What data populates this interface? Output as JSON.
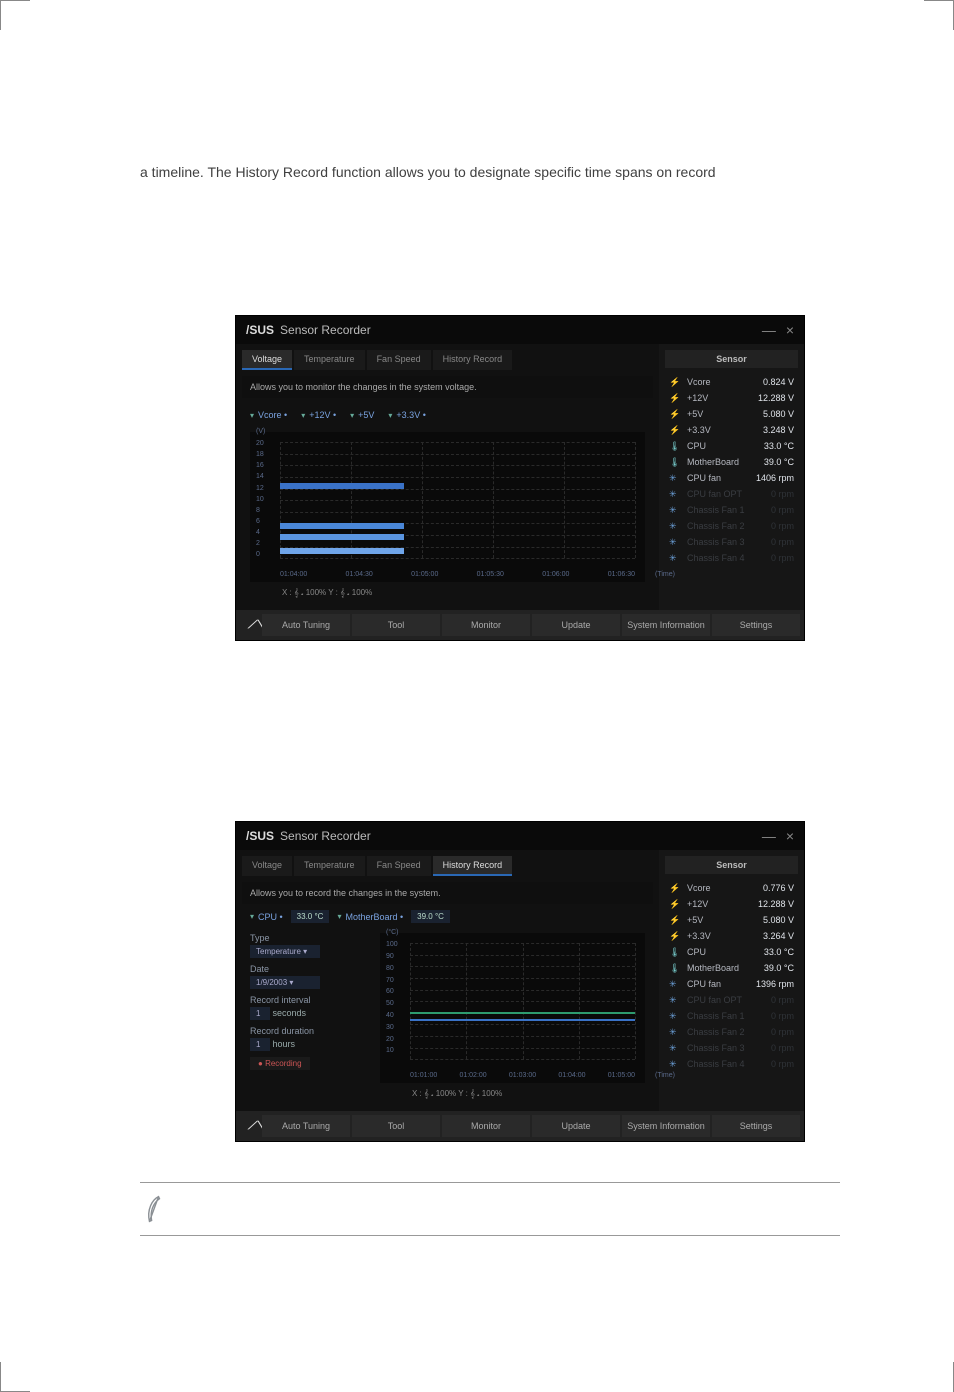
{
  "doc": {
    "paragraph_line": "a timeline. The History Record function allows you to designate specific time spans on record"
  },
  "window": {
    "brand": "/SUS",
    "title": "Sensor Recorder",
    "controls": {
      "min": "—",
      "close": "×"
    }
  },
  "tabs": {
    "voltage": "Voltage",
    "temperature": "Temperature",
    "fan": "Fan Speed",
    "history": "History Record"
  },
  "voltage_view": {
    "desc": "Allows you to monitor the changes in the system voltage.",
    "toggles": [
      "Vcore •",
      "+12V •",
      "+5V",
      "+3.3V •"
    ],
    "y_unit": "(V)",
    "y_ticks": [
      "20",
      "18",
      "16",
      "14",
      "12",
      "10",
      "8",
      "6",
      "4",
      "2",
      "0"
    ],
    "x_ticks": [
      "01:04:00",
      "01:04:30",
      "01:05:00",
      "01:05:30",
      "01:06:00",
      "01:06:30"
    ],
    "x_label": "(Time)",
    "zoom": "X : 𝄞 𝅘  100%    Y : 𝄞 𝅘  100%"
  },
  "history_view": {
    "desc": "Allows you to record the changes in the system.",
    "toggles_row": {
      "cpu": "CPU •",
      "cpu_val": "33.0 °C",
      "mb": "MotherBoard •",
      "mb_val": "39.0 °C"
    },
    "type_label": "Type",
    "type_val": "Temperature",
    "date_label": "Date",
    "date_val": "1/9/2003",
    "ri_label": "Record interval",
    "ri_val": "1",
    "ri_unit": "seconds",
    "rd_label": "Record duration",
    "rd_val": "1",
    "rd_unit": "hours",
    "rec_label": "Recording",
    "y_unit": "(°C)",
    "y_ticks": [
      "100",
      "90",
      "80",
      "70",
      "60",
      "50",
      "40",
      "30",
      "20",
      "10",
      ""
    ],
    "x_ticks": [
      "01:01:00",
      "01:02:00",
      "01:03:00",
      "01:04:00",
      "01:05:00"
    ],
    "x_label": "(Time)",
    "zoom": "X : 𝄞 𝅘  100%    Y : 𝄞 𝅘  100%"
  },
  "sensor": {
    "header": "Sensor",
    "rows1": [
      {
        "k": "Vcore",
        "v": "0.824 V",
        "t": "bolt"
      },
      {
        "k": "+12V",
        "v": "12.288 V",
        "t": "bolt"
      },
      {
        "k": "+5V",
        "v": "5.080 V",
        "t": "bolt"
      },
      {
        "k": "+3.3V",
        "v": "3.248 V",
        "t": "bolt"
      },
      {
        "k": "CPU",
        "v": "33.0 °C",
        "t": "temp"
      },
      {
        "k": "MotherBoard",
        "v": "39.0 °C",
        "t": "temp"
      },
      {
        "k": "CPU fan",
        "v": "1406 rpm",
        "t": "fan"
      },
      {
        "k": "CPU fan OPT",
        "v": "0 rpm",
        "t": "fan",
        "dim": true
      },
      {
        "k": "Chassis Fan 1",
        "v": "0 rpm",
        "t": "fan",
        "dim": true
      },
      {
        "k": "Chassis Fan 2",
        "v": "0 rpm",
        "t": "fan",
        "dim": true
      },
      {
        "k": "Chassis Fan 3",
        "v": "0 rpm",
        "t": "fan",
        "dim": true
      },
      {
        "k": "Chassis Fan 4",
        "v": "0 rpm",
        "t": "fan",
        "dim": true
      }
    ],
    "rows2": [
      {
        "k": "Vcore",
        "v": "0.776 V",
        "t": "bolt"
      },
      {
        "k": "+12V",
        "v": "12.288 V",
        "t": "bolt"
      },
      {
        "k": "+5V",
        "v": "5.080 V",
        "t": "bolt"
      },
      {
        "k": "+3.3V",
        "v": "3.264 V",
        "t": "bolt"
      },
      {
        "k": "CPU",
        "v": "33.0 °C",
        "t": "temp"
      },
      {
        "k": "MotherBoard",
        "v": "39.0 °C",
        "t": "temp"
      },
      {
        "k": "CPU fan",
        "v": "1396 rpm",
        "t": "fan"
      },
      {
        "k": "CPU fan OPT",
        "v": "0 rpm",
        "t": "fan",
        "dim": true
      },
      {
        "k": "Chassis Fan 1",
        "v": "0 rpm",
        "t": "fan",
        "dim": true
      },
      {
        "k": "Chassis Fan 2",
        "v": "0 rpm",
        "t": "fan",
        "dim": true
      },
      {
        "k": "Chassis Fan 3",
        "v": "0 rpm",
        "t": "fan",
        "dim": true
      },
      {
        "k": "Chassis Fan 4",
        "v": "0 rpm",
        "t": "fan",
        "dim": true
      }
    ]
  },
  "bottombar": {
    "auto": "Auto Tuning",
    "tool": "Tool",
    "monitor": "Monitor",
    "update": "Update",
    "sysinfo": "System Information",
    "settings": "Settings"
  },
  "chart_data": [
    {
      "type": "bar",
      "orientation": "horizontal-timeline",
      "title": "System voltage over time",
      "y_unit": "V",
      "ylim": [
        0,
        20
      ],
      "categories": [
        "01:04:00",
        "01:04:30",
        "01:05:00",
        "01:05:30",
        "01:06:00",
        "01:06:30"
      ],
      "series": [
        {
          "name": "Vcore",
          "value_approx": 0.8
        },
        {
          "name": "+12V",
          "value_approx": 12.3
        },
        {
          "name": "+5V",
          "value_approx": 5.1
        },
        {
          "name": "+3.3V",
          "value_approx": 3.2
        }
      ]
    },
    {
      "type": "line",
      "title": "Temperature history",
      "y_unit": "°C",
      "ylim": [
        0,
        100
      ],
      "x": [
        "01:01:00",
        "01:02:00",
        "01:03:00",
        "01:04:00",
        "01:05:00"
      ],
      "series": [
        {
          "name": "CPU",
          "values": [
            33,
            33,
            33,
            33,
            33
          ]
        },
        {
          "name": "MotherBoard",
          "values": [
            39,
            39,
            39,
            39,
            39
          ]
        }
      ]
    }
  ]
}
